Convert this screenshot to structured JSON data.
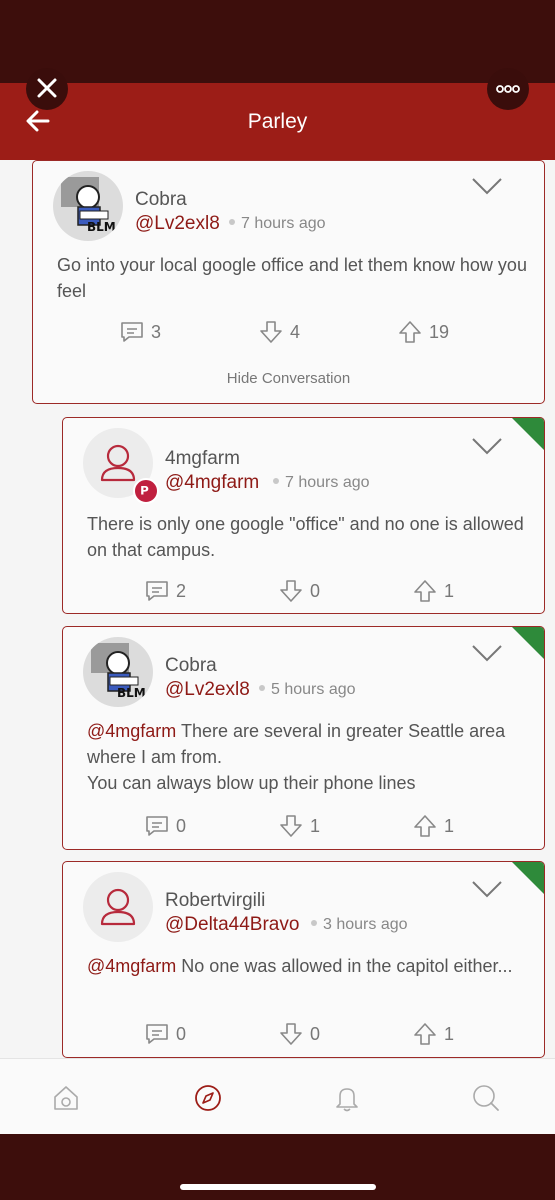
{
  "header": {
    "title": "Parley"
  },
  "posts": [
    {
      "name": "Cobra",
      "handle": "@Lv2exl8",
      "time": "7 hours ago",
      "body": "Go into your local google office and let them know how you feel",
      "comments": "3",
      "downvotes": "4",
      "upvotes": "19",
      "hide_label": "Hide Conversation"
    },
    {
      "name": "4mgfarm",
      "handle": "@4mgfarm",
      "time": "7 hours ago",
      "body": "There is only one google \"office\" and no one is allowed on that campus.",
      "comments": "2",
      "downvotes": "0",
      "upvotes": "1"
    },
    {
      "name": "Cobra",
      "handle": "@Lv2exl8",
      "time": "5 hours ago",
      "mention": "@4mgfarm",
      "body": " There are several in greater Seattle area where I am from.\nYou can always blow up their phone lines",
      "comments": "0",
      "downvotes": "1",
      "upvotes": "1"
    },
    {
      "name": "Robertvirgili",
      "handle": "@Delta44Bravo",
      "time": "3 hours ago",
      "mention": "@4mgfarm",
      "body": " No one was allowed in the capitol either...",
      "comments": "0",
      "downvotes": "0",
      "upvotes": "1"
    }
  ],
  "avatar_badge_text": "P",
  "avatar_caption": "BLM",
  "colors": {
    "brand": "#9c1d17",
    "status_bar": "#3d0e0c",
    "handle": "#8e1a16",
    "corner": "#2e8a3a"
  },
  "tabs": [
    "home-icon",
    "discover-icon",
    "notifications-icon",
    "search-icon"
  ]
}
